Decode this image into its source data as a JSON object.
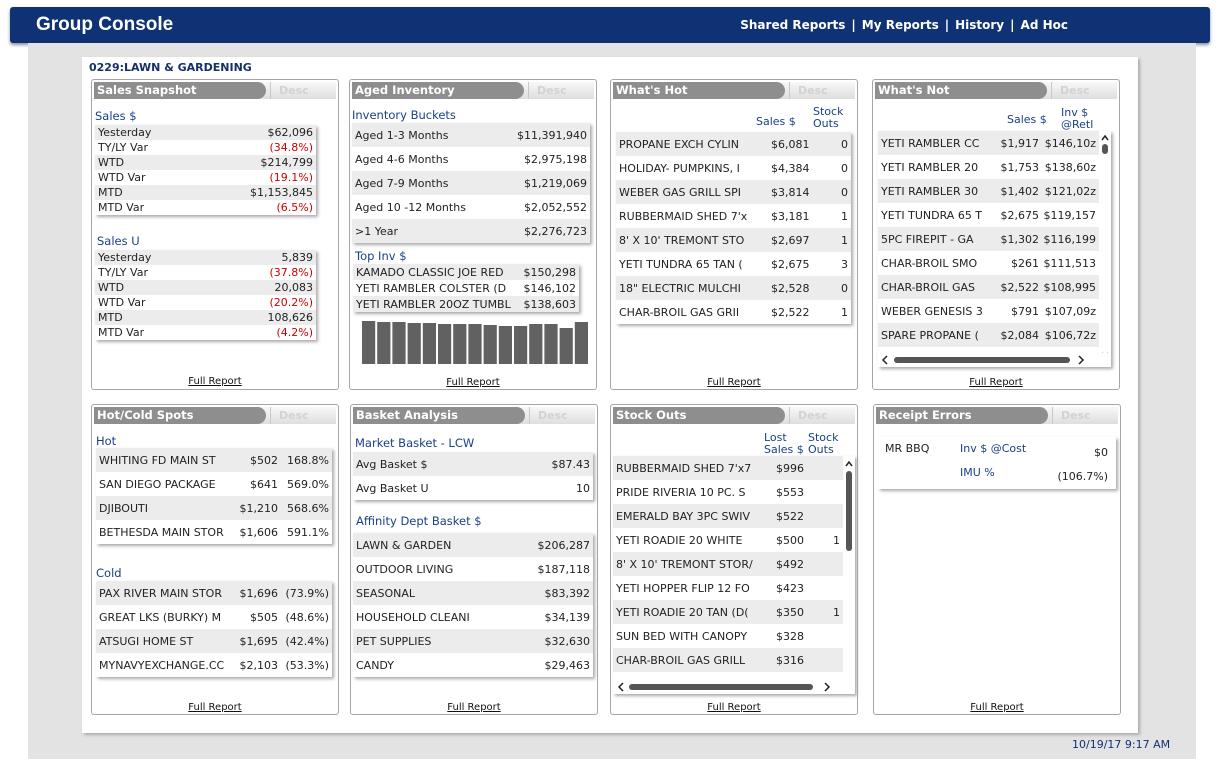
{
  "header": {
    "title": "Group Console",
    "nav": [
      "Shared Reports",
      "My Reports",
      "History",
      "Ad Hoc"
    ],
    "separator": "|"
  },
  "group_title": "0229:LAWN & GARDENING",
  "timestamp": "10/19/17 9:17 AM",
  "desc_label": "Desc",
  "full_report": "Full Report",
  "sales_snapshot": {
    "title": "Sales Snapshot",
    "sales_dollar": {
      "label": "Sales $",
      "rows": [
        {
          "label": "Yesterday",
          "value": "$62,096",
          "neg": false
        },
        {
          "label": "TY/LY Var",
          "value": "(34.8%)",
          "neg": true
        },
        {
          "label": "WTD",
          "value": "$214,799",
          "neg": false
        },
        {
          "label": "WTD Var",
          "value": "(19.1%)",
          "neg": true
        },
        {
          "label": "MTD",
          "value": "$1,153,845",
          "neg": false
        },
        {
          "label": "MTD Var",
          "value": "(6.5%)",
          "neg": true
        }
      ]
    },
    "sales_units": {
      "label": "Sales U",
      "rows": [
        {
          "label": "Yesterday",
          "value": "5,839",
          "neg": false
        },
        {
          "label": "TY/LY Var",
          "value": "(37.8%)",
          "neg": true
        },
        {
          "label": "WTD",
          "value": "20,083",
          "neg": false
        },
        {
          "label": "WTD Var",
          "value": "(20.2%)",
          "neg": true
        },
        {
          "label": "MTD",
          "value": "108,626",
          "neg": false
        },
        {
          "label": "MTD Var",
          "value": "(4.2%)",
          "neg": true
        }
      ]
    }
  },
  "aged_inventory": {
    "title": "Aged Inventory",
    "buckets_label": "Inventory Buckets",
    "buckets": [
      {
        "label": "Aged 1-3 Months",
        "value": "$11,391,940"
      },
      {
        "label": "Aged 4-6 Months",
        "value": "$2,975,198"
      },
      {
        "label": "Aged 7-9 Months",
        "value": "$1,219,069"
      },
      {
        "label": "Aged 10 -12 Months",
        "value": "$2,052,552"
      },
      {
        "label": ">1 Year",
        "value": "$2,276,723"
      }
    ],
    "top_label": "Top Inv $",
    "top": [
      {
        "label": "KAMADO CLASSIC JOE RED",
        "value": "$150,298"
      },
      {
        "label": "YETI RAMBLER COLSTER (D",
        "value": "$146,102"
      },
      {
        "label": "YETI RAMBLER 20OZ TUMBL",
        "value": "$138,603"
      }
    ],
    "sparkbar_levels": [
      0.97,
      0.96,
      0.95,
      0.94,
      0.93,
      0.92,
      0.91,
      0.9,
      0.88,
      0.87,
      0.86,
      0.92,
      0.9,
      0.82,
      0.95
    ],
    "bar_color": "#616161"
  },
  "whats_hot": {
    "title": "What's Hot",
    "col_sales": "Sales $",
    "col_stock": [
      "Stock",
      "Outs"
    ],
    "rows": [
      {
        "name": "PROPANE  EXCH CYLIN",
        "sales": "$6,081",
        "outs": "0"
      },
      {
        "name": "HOLIDAY- PUMPKINS, I",
        "sales": "$4,384",
        "outs": "0"
      },
      {
        "name": "WEBER GAS GRILL SPI",
        "sales": "$3,814",
        "outs": "0"
      },
      {
        "name": "RUBBERMAID SHED 7'x",
        "sales": "$3,181",
        "outs": "1"
      },
      {
        "name": "8' X 10' TREMONT STO",
        "sales": "$2,697",
        "outs": "1"
      },
      {
        "name": "YETI TUNDRA 65 TAN (",
        "sales": "$2,675",
        "outs": "3"
      },
      {
        "name": "18\" ELECTRIC MULCHI",
        "sales": "$2,528",
        "outs": "0"
      },
      {
        "name": "CHAR-BROIL GAS GRII",
        "sales": "$2,522",
        "outs": "1"
      }
    ]
  },
  "whats_not": {
    "title": "What's Not",
    "col_sales": "Sales $",
    "col_inv": [
      "Inv $",
      "@Retl"
    ],
    "rows": [
      {
        "name": "YETI RAMBLER CC",
        "sales": "$1,917",
        "inv": "$146,10z"
      },
      {
        "name": "YETI RAMBLER 20",
        "sales": "$1,753",
        "inv": "$138,60z"
      },
      {
        "name": "YETI RAMBLER 30",
        "sales": "$1,402",
        "inv": "$121,02z"
      },
      {
        "name": "YETI TUNDRA 65 T",
        "sales": "$2,675",
        "inv": "$119,157"
      },
      {
        "name": "5PC FIREPIT - GA",
        "sales": "$1,302",
        "inv": "$116,199"
      },
      {
        "name": "CHAR-BROIL SMO",
        "sales": "$261",
        "inv": "$111,513"
      },
      {
        "name": "CHAR-BROIL GAS",
        "sales": "$2,522",
        "inv": "$108,995"
      },
      {
        "name": "WEBER GENESIS 3",
        "sales": "$791",
        "inv": "$107,09z"
      },
      {
        "name": "SPARE PROPANE (",
        "sales": "$2,084",
        "inv": "$106,72z"
      }
    ]
  },
  "hot_cold": {
    "title": "Hot/Cold Spots",
    "hot_label": "Hot",
    "hot": [
      {
        "name": "WHITING FD MAIN ST",
        "sales": "$502",
        "pct": "168.8%"
      },
      {
        "name": "SAN DIEGO PACKAGE",
        "sales": "$641",
        "pct": "569.0%"
      },
      {
        "name": "DJIBOUTI",
        "sales": "$1,210",
        "pct": "568.6%"
      },
      {
        "name": "BETHESDA MAIN STOR",
        "sales": "$1,606",
        "pct": "591.1%"
      }
    ],
    "cold_label": "Cold",
    "cold": [
      {
        "name": "PAX RIVER MAIN STOR",
        "sales": "$1,696",
        "pct": "(73.9%)"
      },
      {
        "name": "GREAT LKS (BURKY) M",
        "sales": "$505",
        "pct": "(48.6%)"
      },
      {
        "name": "ATSUGI HOME ST",
        "sales": "$1,695",
        "pct": "(42.4%)"
      },
      {
        "name": "MYNAVYEXCHANGE.CC",
        "sales": "$2,103",
        "pct": "(53.3%)"
      }
    ]
  },
  "basket": {
    "title": "Basket Analysis",
    "market_label": "Market Basket - LCW",
    "market": [
      {
        "label": "Avg Basket $",
        "value": "$87.43"
      },
      {
        "label": "Avg Basket U",
        "value": "10"
      }
    ],
    "affinity_label": "Affinity Dept Basket $",
    "affinity": [
      {
        "label": "LAWN & GARDEN",
        "value": "$206,287"
      },
      {
        "label": "OUTDOOR LIVING",
        "value": "$187,118"
      },
      {
        "label": "SEASONAL",
        "value": "$83,392"
      },
      {
        "label": "HOUSEHOLD CLEANI",
        "value": "$34,139"
      },
      {
        "label": "PET SUPPLIES",
        "value": "$32,630"
      },
      {
        "label": "CANDY",
        "value": "$29,463"
      }
    ]
  },
  "stock_outs": {
    "title": "Stock Outs",
    "col_lost": [
      "Lost",
      "Sales $"
    ],
    "col_stock": [
      "Stock",
      "Outs"
    ],
    "rows": [
      {
        "name": "RUBBERMAID SHED 7'x7",
        "lost": "$996",
        "outs": ""
      },
      {
        "name": "PRIDE RIVERIA 10 PC. S",
        "lost": "$553",
        "outs": ""
      },
      {
        "name": "EMERALD BAY 3PC SWIV",
        "lost": "$522",
        "outs": ""
      },
      {
        "name": "YETI ROADIE 20 WHITE",
        "lost": "$500",
        "outs": "1"
      },
      {
        "name": "8' X 10' TREMONT STOR/",
        "lost": "$492",
        "outs": ""
      },
      {
        "name": "YETI HOPPER FLIP 12 FO",
        "lost": "$423",
        "outs": ""
      },
      {
        "name": "YETI ROADIE 20 TAN (D(",
        "lost": "$350",
        "outs": "1"
      },
      {
        "name": "SUN BED WITH CANOPY",
        "lost": "$328",
        "outs": ""
      },
      {
        "name": "CHAR-BROIL GAS GRILL",
        "lost": "$316",
        "outs": ""
      }
    ]
  },
  "receipt_errors": {
    "title": "Receipt Errors",
    "store": "MR BBQ",
    "rows": [
      {
        "label": "Inv $ @Cost",
        "value": "$0"
      },
      {
        "label": "IMU %",
        "value": "(106.7%)"
      }
    ]
  }
}
